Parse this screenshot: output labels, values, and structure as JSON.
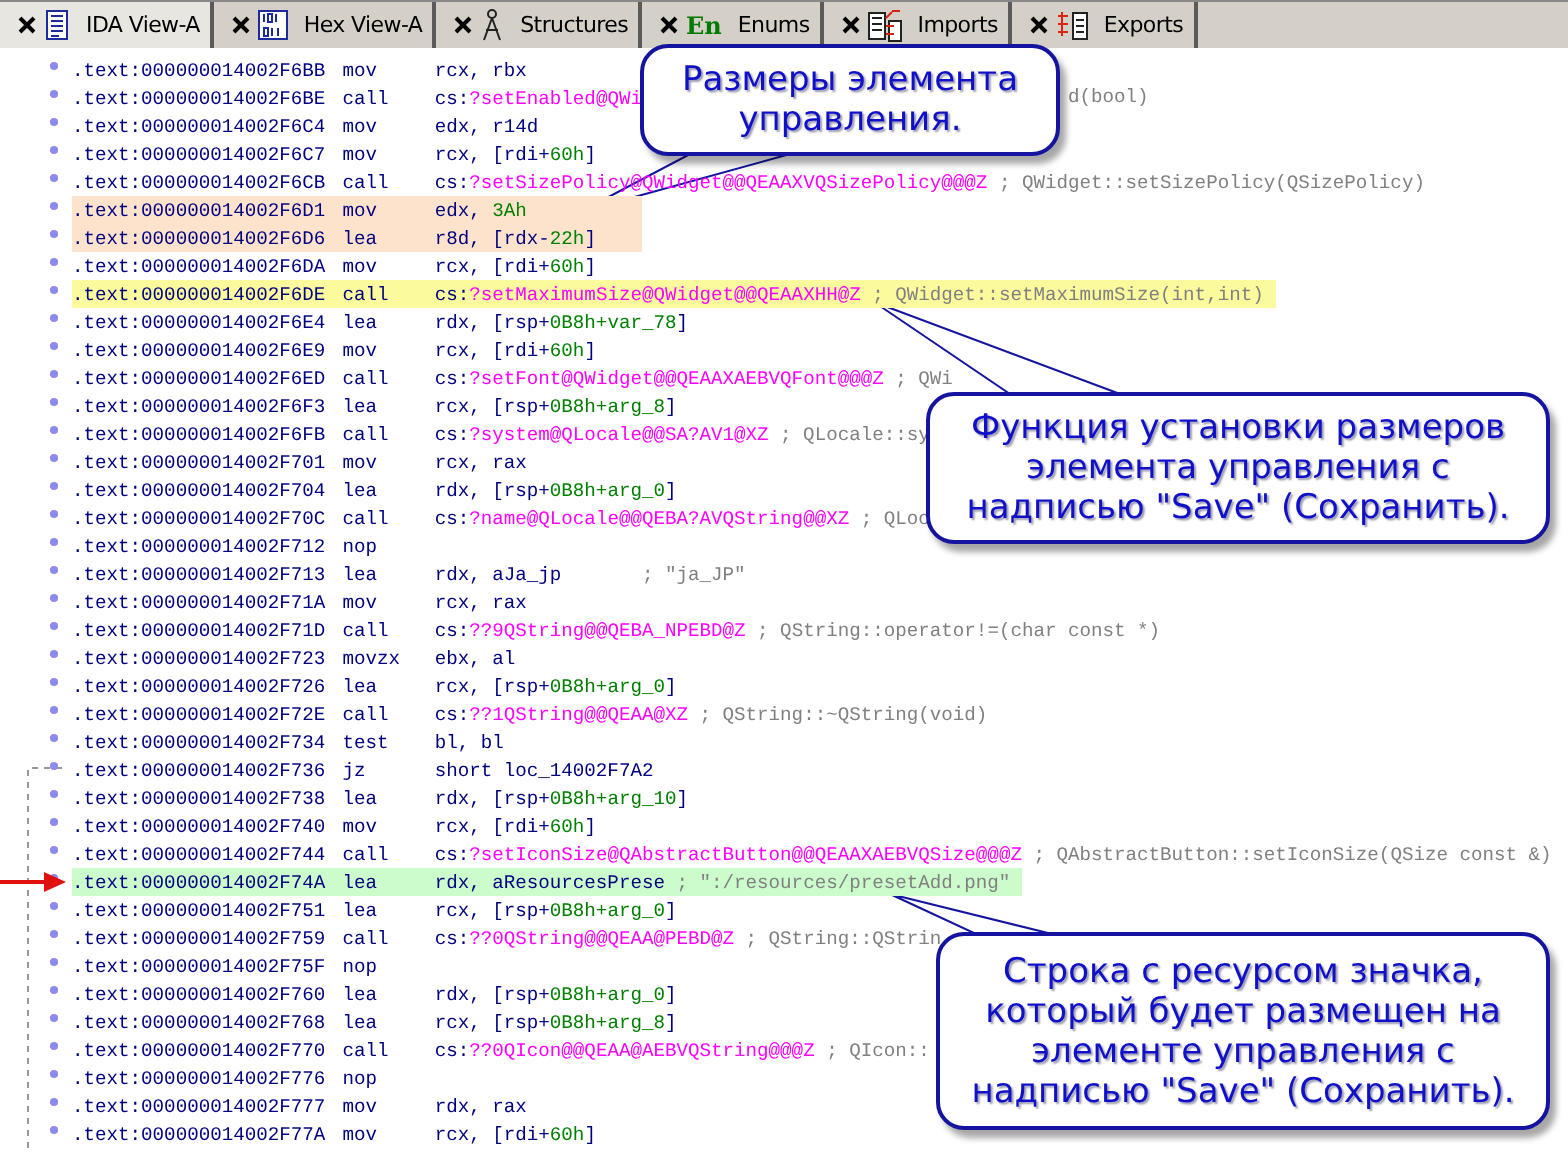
{
  "tabs": [
    {
      "label": "IDA View-A",
      "selected": true
    },
    {
      "label": "Hex View-A",
      "selected": false
    },
    {
      "label": "Structures",
      "selected": false
    },
    {
      "label": "Enums",
      "selected": false,
      "icon_text": "En"
    },
    {
      "label": "Imports",
      "selected": false
    },
    {
      "label": "Exports",
      "selected": false
    }
  ],
  "rows": [
    {
      "address": ".text:000000014002F6BB",
      "mnemonic": "mov",
      "operand": [
        {
          "text": "rcx, rbx",
          "kind": "plain"
        }
      ],
      "arrow": false
    },
    {
      "address": ".text:000000014002F6BE",
      "mnemonic": "call",
      "operand": [
        {
          "text": "cs:",
          "kind": "plain"
        },
        {
          "text": "?setEnabled@QWi",
          "kind": "name"
        }
      ],
      "tail": "d(bool)",
      "arrow": false
    },
    {
      "address": ".text:000000014002F6C4",
      "mnemonic": "mov",
      "operand": [
        {
          "text": "edx, r14d",
          "kind": "plain"
        }
      ],
      "arrow": false
    },
    {
      "address": ".text:000000014002F6C7",
      "mnemonic": "mov",
      "operand": [
        {
          "text": "rcx, [rdi+",
          "kind": "plain"
        },
        {
          "text": "60h",
          "kind": "number"
        },
        {
          "text": "]",
          "kind": "plain"
        }
      ],
      "arrow": false
    },
    {
      "address": ".text:000000014002F6CB",
      "mnemonic": "call",
      "operand": [
        {
          "text": "cs:",
          "kind": "plain"
        },
        {
          "text": "?setSizePolicy@QWidget@@QEAAXVQSizePolicy@@@Z",
          "kind": "name"
        }
      ],
      "comment": "; QWidget::setSizePolicy(QSizePolicy)",
      "arrow": false
    },
    {
      "address": ".text:000000014002F6D1",
      "mnemonic": "mov",
      "operand": [
        {
          "text": "edx, ",
          "kind": "plain"
        },
        {
          "text": "3Ah",
          "kind": "number"
        }
      ],
      "arrow": false,
      "color": "#fde3cc"
    },
    {
      "address": ".text:000000014002F6D6",
      "mnemonic": "lea",
      "operand": [
        {
          "text": "r8d, [rdx-",
          "kind": "plain"
        },
        {
          "text": "22h",
          "kind": "number"
        },
        {
          "text": "]",
          "kind": "plain"
        }
      ],
      "arrow": false,
      "color": "#fde3cc"
    },
    {
      "address": ".text:000000014002F6DA",
      "mnemonic": "mov",
      "operand": [
        {
          "text": "rcx, [rdi+",
          "kind": "plain"
        },
        {
          "text": "60h",
          "kind": "number"
        },
        {
          "text": "]",
          "kind": "plain"
        }
      ],
      "arrow": false
    },
    {
      "address": ".text:000000014002F6DE",
      "mnemonic": "call",
      "operand": [
        {
          "text": "cs:",
          "kind": "plain"
        },
        {
          "text": "?setMaximumSize@QWidget@@QEAAXHH@Z",
          "kind": "name"
        }
      ],
      "comment": "; QWidget::setMaximumSize(int,int)",
      "arrow": false,
      "color": "#fbfb9e"
    },
    {
      "address": ".text:000000014002F6E4",
      "mnemonic": "lea",
      "operand": [
        {
          "text": "rdx, [rsp+",
          "kind": "plain"
        },
        {
          "text": "0B8h+var_78",
          "kind": "number"
        },
        {
          "text": "]",
          "kind": "plain"
        }
      ],
      "arrow": false
    },
    {
      "address": ".text:000000014002F6E9",
      "mnemonic": "mov",
      "operand": [
        {
          "text": "rcx, [rdi+",
          "kind": "plain"
        },
        {
          "text": "60h",
          "kind": "number"
        },
        {
          "text": "]",
          "kind": "plain"
        }
      ],
      "arrow": false
    },
    {
      "address": ".text:000000014002F6ED",
      "mnemonic": "call",
      "operand": [
        {
          "text": "cs:",
          "kind": "plain"
        },
        {
          "text": "?setFont@QWidget@@QEAAXAEBVQFont@@@Z",
          "kind": "name"
        }
      ],
      "comment": "; QWi",
      "arrow": false
    },
    {
      "address": ".text:000000014002F6F3",
      "mnemonic": "lea",
      "operand": [
        {
          "text": "rcx, [rsp+",
          "kind": "plain"
        },
        {
          "text": "0B8h+arg_8",
          "kind": "number"
        },
        {
          "text": "]",
          "kind": "plain"
        }
      ],
      "arrow": false
    },
    {
      "address": ".text:000000014002F6FB",
      "mnemonic": "call",
      "operand": [
        {
          "text": "cs:",
          "kind": "plain"
        },
        {
          "text": "?system@QLocale@@SA?AV1@XZ",
          "kind": "name"
        }
      ],
      "comment": "; QLocale::sy",
      "arrow": false
    },
    {
      "address": ".text:000000014002F701",
      "mnemonic": "mov",
      "operand": [
        {
          "text": "rcx, rax",
          "kind": "plain"
        }
      ],
      "arrow": false
    },
    {
      "address": ".text:000000014002F704",
      "mnemonic": "lea",
      "operand": [
        {
          "text": "rdx, [rsp+",
          "kind": "plain"
        },
        {
          "text": "0B8h+arg_0",
          "kind": "number"
        },
        {
          "text": "]",
          "kind": "plain"
        }
      ],
      "arrow": false
    },
    {
      "address": ".text:000000014002F70C",
      "mnemonic": "call",
      "operand": [
        {
          "text": "cs:",
          "kind": "plain"
        },
        {
          "text": "?name@QLocale@@QEBA?AVQString@@XZ",
          "kind": "name"
        }
      ],
      "comment": "; QLoc",
      "arrow": false
    },
    {
      "address": ".text:000000014002F712",
      "mnemonic": "nop",
      "operand": [],
      "arrow": false
    },
    {
      "address": ".text:000000014002F713",
      "mnemonic": "lea",
      "operand": [
        {
          "text": "rdx, aJa_jp",
          "kind": "plain"
        }
      ],
      "comment": "; \"ja_JP\"",
      "arrow": false
    },
    {
      "address": ".text:000000014002F71A",
      "mnemonic": "mov",
      "operand": [
        {
          "text": "rcx, rax",
          "kind": "plain"
        }
      ],
      "arrow": false
    },
    {
      "address": ".text:000000014002F71D",
      "mnemonic": "call",
      "operand": [
        {
          "text": "cs:",
          "kind": "plain"
        },
        {
          "text": "??9QString@@QEBA_NPEBD@Z",
          "kind": "name"
        }
      ],
      "comment": "; QString::operator!=(char const *)",
      "arrow": false
    },
    {
      "address": ".text:000000014002F723",
      "mnemonic": "movzx",
      "operand": [
        {
          "text": "ebx, al",
          "kind": "plain"
        }
      ],
      "arrow": false
    },
    {
      "address": ".text:000000014002F726",
      "mnemonic": "lea",
      "operand": [
        {
          "text": "rcx, [rsp+",
          "kind": "plain"
        },
        {
          "text": "0B8h+arg_0",
          "kind": "number"
        },
        {
          "text": "]",
          "kind": "plain"
        }
      ],
      "arrow": false
    },
    {
      "address": ".text:000000014002F72E",
      "mnemonic": "call",
      "operand": [
        {
          "text": "cs:",
          "kind": "plain"
        },
        {
          "text": "??1QString@@QEAA@XZ",
          "kind": "name"
        }
      ],
      "comment": "; QString::~QString(void)",
      "arrow": false
    },
    {
      "address": ".text:000000014002F734",
      "mnemonic": "test",
      "operand": [
        {
          "text": "bl, bl",
          "kind": "plain"
        }
      ],
      "arrow": false
    },
    {
      "address": ".text:000000014002F736",
      "mnemonic": "jz",
      "operand": [
        {
          "text": "short loc_14002F7A2",
          "kind": "plain"
        }
      ],
      "arrow": false
    },
    {
      "address": ".text:000000014002F738",
      "mnemonic": "lea",
      "operand": [
        {
          "text": "rdx, [rsp+",
          "kind": "plain"
        },
        {
          "text": "0B8h+arg_10",
          "kind": "number"
        },
        {
          "text": "]",
          "kind": "plain"
        }
      ],
      "arrow": false
    },
    {
      "address": ".text:000000014002F740",
      "mnemonic": "mov",
      "operand": [
        {
          "text": "rcx, [rdi+",
          "kind": "plain"
        },
        {
          "text": "60h",
          "kind": "number"
        },
        {
          "text": "]",
          "kind": "plain"
        }
      ],
      "arrow": false
    },
    {
      "address": ".text:000000014002F744",
      "mnemonic": "call",
      "operand": [
        {
          "text": "cs:",
          "kind": "plain"
        },
        {
          "text": "?setIconSize@QAbstractButton@@QEAAXAEBVQSize@@@Z",
          "kind": "name"
        }
      ],
      "comment": "; QAbstractButton::setIconSize(QSize const &)",
      "arrow": false
    },
    {
      "address": ".text:000000014002F74A",
      "mnemonic": "lea",
      "operand": [
        {
          "text": "rdx, aResourcesPrese",
          "kind": "plain"
        }
      ],
      "comment": "; \":/resources/presetAdd.png\"",
      "arrow": true,
      "color": "#ccfccc"
    },
    {
      "address": ".text:000000014002F751",
      "mnemonic": "lea",
      "operand": [
        {
          "text": "rcx, [rsp+",
          "kind": "plain"
        },
        {
          "text": "0B8h+arg_0",
          "kind": "number"
        },
        {
          "text": "]",
          "kind": "plain"
        }
      ],
      "arrow": false
    },
    {
      "address": ".text:000000014002F759",
      "mnemonic": "call",
      "operand": [
        {
          "text": "cs:",
          "kind": "plain"
        },
        {
          "text": "??0QString@@QEAA@PEBD@Z",
          "kind": "name"
        }
      ],
      "comment": "; QString::QStrin",
      "arrow": false
    },
    {
      "address": ".text:000000014002F75F",
      "mnemonic": "nop",
      "operand": [],
      "arrow": false
    },
    {
      "address": ".text:000000014002F760",
      "mnemonic": "lea",
      "operand": [
        {
          "text": "rdx, [rsp+",
          "kind": "plain"
        },
        {
          "text": "0B8h+arg_0",
          "kind": "number"
        },
        {
          "text": "]",
          "kind": "plain"
        }
      ],
      "arrow": false
    },
    {
      "address": ".text:000000014002F768",
      "mnemonic": "lea",
      "operand": [
        {
          "text": "rcx, [rsp+",
          "kind": "plain"
        },
        {
          "text": "0B8h+arg_8",
          "kind": "number"
        },
        {
          "text": "]",
          "kind": "plain"
        }
      ],
      "arrow": false
    },
    {
      "address": ".text:000000014002F770",
      "mnemonic": "call",
      "operand": [
        {
          "text": "cs:",
          "kind": "plain"
        },
        {
          "text": "??0QIcon@@QEAA@AEBVQString@@@Z",
          "kind": "name"
        }
      ],
      "comment": "; QIcon::",
      "arrow": false
    },
    {
      "address": ".text:000000014002F776",
      "mnemonic": "nop",
      "operand": [],
      "arrow": false
    },
    {
      "address": ".text:000000014002F777",
      "mnemonic": "mov",
      "operand": [
        {
          "text": "rdx, rax",
          "kind": "plain"
        }
      ],
      "arrow": false
    },
    {
      "address": ".text:000000014002F77A",
      "mnemonic": "mov",
      "operand": [
        {
          "text": "rcx, [rdi+",
          "kind": "plain"
        },
        {
          "text": "60h",
          "kind": "number"
        },
        {
          "text": "]",
          "kind": "plain"
        }
      ],
      "arrow": false
    }
  ],
  "callouts": [
    {
      "lines": [
        "Размеры элемента",
        "управления."
      ]
    },
    {
      "lines": [
        "Функция установки размеров",
        "элемента управления с",
        "надписью \"Save\" (Сохранить)."
      ]
    },
    {
      "lines": [
        "Строка с ресурсом значка,",
        "который будет размещен на",
        "элементе управления с",
        "надписью \"Save\" (Сохранить)."
      ]
    }
  ]
}
